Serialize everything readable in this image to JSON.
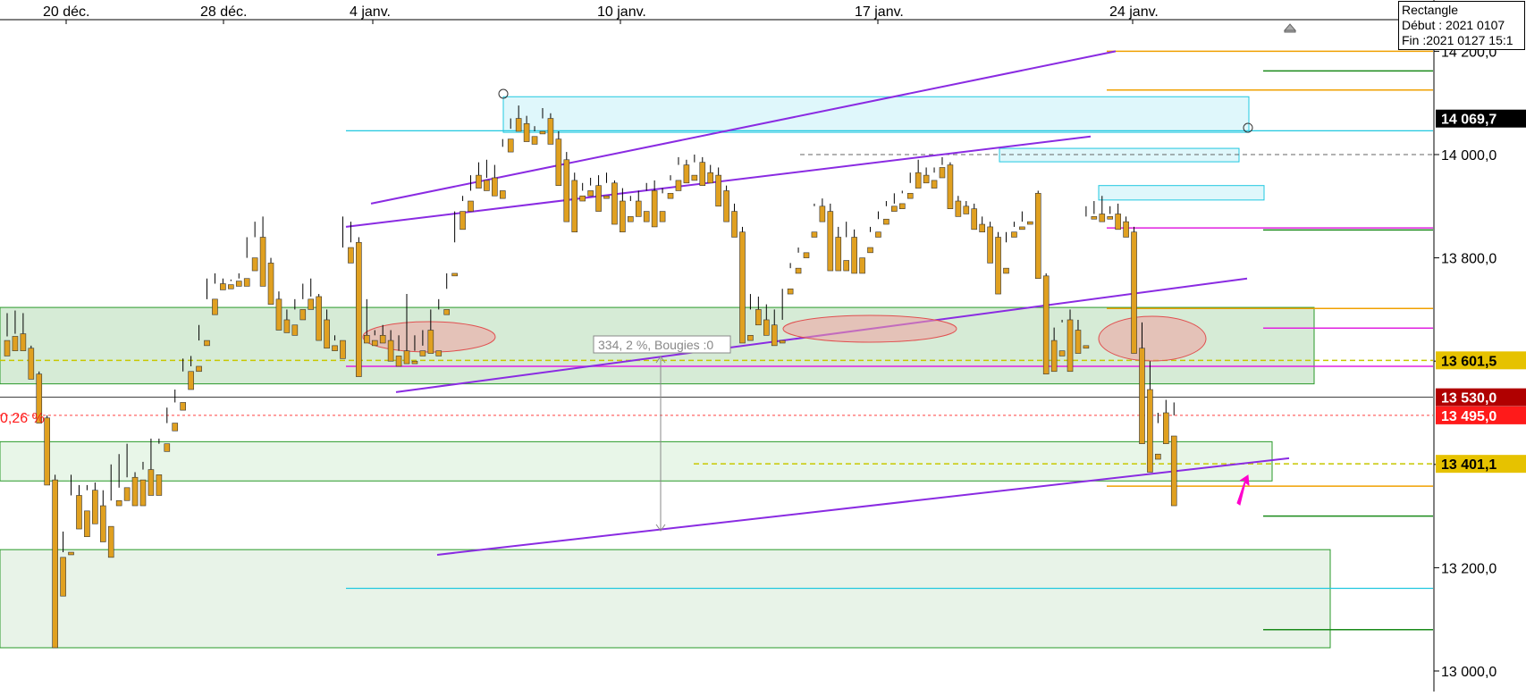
{
  "chart_data": {
    "type": "candlestick",
    "x_axis_labels": [
      "20 déc.",
      "28 déc.",
      "4 janv.",
      "10 janv.",
      "17 janv.",
      "24 janv."
    ],
    "y_ticks": [
      13000,
      13200,
      13400,
      13600,
      13800,
      14000,
      14200
    ],
    "y_tick_labels": [
      "13 000,0",
      "13 200,0",
      "13 400,0",
      "13 600,0",
      "13 800,0",
      "14 000,0",
      "14 200,0"
    ],
    "ylim": [
      12975,
      14225
    ],
    "price_tags": [
      {
        "label": "14 069,7",
        "value": 14069.7,
        "color": "#000000"
      },
      {
        "label": "13 601,5",
        "value": 13601.5,
        "color": "#e6c200"
      },
      {
        "label": "13 530,0",
        "value": 13530.0,
        "color": "#b00000"
      },
      {
        "label": "13 495,0",
        "value": 13495.0,
        "color": "#ff1a1a"
      },
      {
        "label": "13 401,1",
        "value": 13401.1,
        "color": "#e6c200"
      }
    ],
    "percent_label": "0,26 %",
    "measure_label": "334, 2 %, Bougies :0",
    "colors": {
      "up": "#2ec4d8",
      "down": "#e0a020",
      "wick": "#000000",
      "channel": "#8a2be2",
      "zone": "#cfe8cf",
      "zone_border": "#2a9a2a",
      "cyan": "#20c8e0",
      "magenta": "#e020e0",
      "orange": "#f0a000",
      "green": "#1a8a1a",
      "arrow": "#ff00cc"
    },
    "candles": [
      [
        13640,
        13693,
        13648,
        13610
      ],
      [
        13648,
        13698,
        13653,
        13620
      ],
      [
        13653,
        13693,
        13625,
        13620
      ],
      [
        13625,
        13630,
        13575,
        13565
      ],
      [
        13575,
        13580,
        13490,
        13480
      ],
      [
        13490,
        13495,
        13370,
        13360
      ],
      [
        13370,
        13380,
        13220,
        13045
      ],
      [
        13220,
        13270,
        13230,
        13145
      ],
      [
        13230,
        13380,
        13340,
        13225
      ],
      [
        13340,
        13360,
        13310,
        13275
      ],
      [
        13310,
        13360,
        13350,
        13260
      ],
      [
        13350,
        13365,
        13320,
        13285
      ],
      [
        13320,
        13350,
        13280,
        13250
      ],
      [
        13280,
        13400,
        13330,
        13220
      ],
      [
        13330,
        13420,
        13355,
        13320
      ],
      [
        13355,
        13440,
        13375,
        13330
      ],
      [
        13375,
        13385,
        13370,
        13320
      ],
      [
        13370,
        13405,
        13390,
        13320
      ],
      [
        13390,
        13450,
        13380,
        13340
      ],
      [
        13380,
        13450,
        13440,
        13340
      ],
      [
        13440,
        13510,
        13480,
        13425
      ],
      [
        13480,
        13545,
        13520,
        13465
      ],
      [
        13520,
        13605,
        13580,
        13505
      ],
      [
        13580,
        13610,
        13590,
        13545
      ],
      [
        13590,
        13670,
        13640,
        13580
      ],
      [
        13640,
        13760,
        13720,
        13630
      ],
      [
        13720,
        13770,
        13750,
        13690
      ],
      [
        13750,
        13760,
        13748,
        13738
      ],
      [
        13748,
        13758,
        13755,
        13740
      ],
      [
        13755,
        13770,
        13760,
        13745
      ],
      [
        13760,
        13840,
        13800,
        13745
      ],
      [
        13800,
        13870,
        13840,
        13775
      ],
      [
        13840,
        13880,
        13790,
        13745
      ],
      [
        13790,
        13800,
        13720,
        13710
      ],
      [
        13720,
        13735,
        13680,
        13660
      ],
      [
        13680,
        13700,
        13670,
        13655
      ],
      [
        13670,
        13720,
        13700,
        13650
      ],
      [
        13700,
        13750,
        13720,
        13680
      ],
      [
        13720,
        13760,
        13725,
        13700
      ],
      [
        13725,
        13730,
        13680,
        13640
      ],
      [
        13680,
        13700,
        13630,
        13625
      ],
      [
        13630,
        13650,
        13640,
        13620
      ],
      [
        13640,
        13880,
        13820,
        13605
      ],
      [
        13820,
        13870,
        13830,
        13790
      ],
      [
        13830,
        13840,
        13650,
        13570
      ],
      [
        13650,
        13720,
        13640,
        13635
      ],
      [
        13640,
        13660,
        13650,
        13630
      ],
      [
        13650,
        13670,
        13640,
        13635
      ],
      [
        13640,
        13660,
        13610,
        13600
      ],
      [
        13610,
        13650,
        13620,
        13590
      ],
      [
        13620,
        13730,
        13600,
        13595
      ],
      [
        13600,
        13650,
        13620,
        13595
      ],
      [
        13620,
        13630,
        13660,
        13610
      ],
      [
        13660,
        13700,
        13620,
        13615
      ],
      [
        13620,
        13720,
        13700,
        13610
      ],
      [
        13700,
        13740,
        13770,
        13690
      ],
      [
        13770,
        13830,
        13890,
        13765
      ],
      [
        13890,
        13920,
        13910,
        13855
      ],
      [
        13910,
        13930,
        13960,
        13890
      ],
      [
        13960,
        13985,
        13950,
        13935
      ],
      [
        13950,
        13990,
        13955,
        13930
      ],
      [
        13955,
        13980,
        13930,
        13920
      ],
      [
        13930,
        14015,
        14030,
        13915
      ],
      [
        14030,
        14050,
        14070,
        14005
      ],
      [
        14070,
        14095,
        14060,
        14045
      ],
      [
        14060,
        14075,
        14035,
        14025
      ],
      [
        14035,
        14055,
        14045,
        14020
      ],
      [
        14045,
        14090,
        14070,
        14040
      ],
      [
        14070,
        14080,
        14030,
        14020
      ],
      [
        14030,
        14045,
        13990,
        13940
      ],
      [
        13990,
        14005,
        13950,
        13870
      ],
      [
        13950,
        13965,
        13920,
        13850
      ],
      [
        13920,
        13945,
        13930,
        13910
      ],
      [
        13930,
        13955,
        13940,
        13920
      ],
      [
        13940,
        13960,
        13920,
        13890
      ],
      [
        13920,
        13965,
        13945,
        13915
      ],
      [
        13945,
        13950,
        13910,
        13865
      ],
      [
        13910,
        13935,
        13880,
        13850
      ],
      [
        13880,
        13920,
        13910,
        13870
      ],
      [
        13910,
        13930,
        13890,
        13880
      ],
      [
        13890,
        13945,
        13930,
        13870
      ],
      [
        13930,
        13950,
        13890,
        13860
      ],
      [
        13890,
        13935,
        13925,
        13870
      ],
      [
        13925,
        13960,
        13950,
        13915
      ],
      [
        13950,
        13995,
        13980,
        13930
      ],
      [
        13980,
        13990,
        13960,
        13945
      ],
      [
        13960,
        14000,
        13985,
        13950
      ],
      [
        13985,
        13995,
        13965,
        13940
      ],
      [
        13965,
        13980,
        13960,
        13945
      ],
      [
        13960,
        13975,
        13930,
        13900
      ],
      [
        13930,
        13940,
        13890,
        13870
      ],
      [
        13890,
        13905,
        13850,
        13840
      ],
      [
        13850,
        13860,
        13650,
        13635
      ],
      [
        13650,
        13730,
        13700,
        13640
      ],
      [
        13700,
        13725,
        13680,
        13670
      ],
      [
        13680,
        13710,
        13670,
        13650
      ],
      [
        13670,
        13700,
        13640,
        13630
      ],
      [
        13640,
        13680,
        13740,
        13635
      ],
      [
        13740,
        13790,
        13780,
        13730
      ],
      [
        13780,
        13820,
        13810,
        13770
      ],
      [
        13810,
        13850,
        13850,
        13800
      ],
      [
        13850,
        13905,
        13900,
        13840
      ],
      [
        13900,
        13915,
        13890,
        13870
      ],
      [
        13890,
        13905,
        13840,
        13775
      ],
      [
        13840,
        13860,
        13795,
        13775
      ],
      [
        13795,
        13870,
        13840,
        13775
      ],
      [
        13840,
        13855,
        13800,
        13770
      ],
      [
        13800,
        13820,
        13820,
        13770
      ],
      [
        13820,
        13860,
        13850,
        13810
      ],
      [
        13850,
        13890,
        13875,
        13840
      ],
      [
        13875,
        13910,
        13900,
        13865
      ],
      [
        13900,
        13925,
        13905,
        13890
      ],
      [
        13905,
        13930,
        13925,
        13895
      ],
      [
        13925,
        13945,
        13965,
        13915
      ],
      [
        13965,
        13990,
        13960,
        13935
      ],
      [
        13960,
        13975,
        13950,
        13945
      ],
      [
        13950,
        13965,
        13975,
        13935
      ],
      [
        13975,
        13995,
        13980,
        13955
      ],
      [
        13980,
        13985,
        13910,
        13895
      ],
      [
        13910,
        13920,
        13900,
        13880
      ],
      [
        13900,
        13910,
        13895,
        13885
      ],
      [
        13895,
        13905,
        13865,
        13855
      ],
      [
        13865,
        13880,
        13860,
        13850
      ],
      [
        13860,
        13870,
        13840,
        13790
      ],
      [
        13840,
        13850,
        13780,
        13730
      ],
      [
        13780,
        13830,
        13850,
        13770
      ],
      [
        13850,
        13870,
        13860,
        13840
      ],
      [
        13860,
        13890,
        13870,
        13855
      ],
      [
        13870,
        13925,
        13925,
        13865
      ],
      [
        13925,
        13930,
        13765,
        13760
      ],
      [
        13765,
        13770,
        13640,
        13575
      ],
      [
        13640,
        13665,
        13620,
        13580
      ],
      [
        13620,
        13675,
        13680,
        13610
      ],
      [
        13680,
        13700,
        13660,
        13580
      ],
      [
        13660,
        13680,
        13630,
        13615
      ],
      [
        13630,
        13900,
        13880,
        13625
      ],
      [
        13880,
        13910,
        13885,
        13875
      ],
      [
        13885,
        13920,
        13880,
        13870
      ],
      [
        13880,
        13900,
        13885,
        13875
      ],
      [
        13885,
        13905,
        13870,
        13855
      ],
      [
        13870,
        13880,
        13850,
        13840
      ],
      [
        13850,
        13860,
        13625,
        13615
      ],
      [
        13625,
        13675,
        13545,
        13440
      ],
      [
        13545,
        13600,
        13420,
        13385
      ],
      [
        13420,
        13480,
        13500,
        13410
      ],
      [
        13500,
        13525,
        13455,
        13440
      ],
      [
        13455,
        13520,
        13495,
        13320
      ]
    ]
  }
}
